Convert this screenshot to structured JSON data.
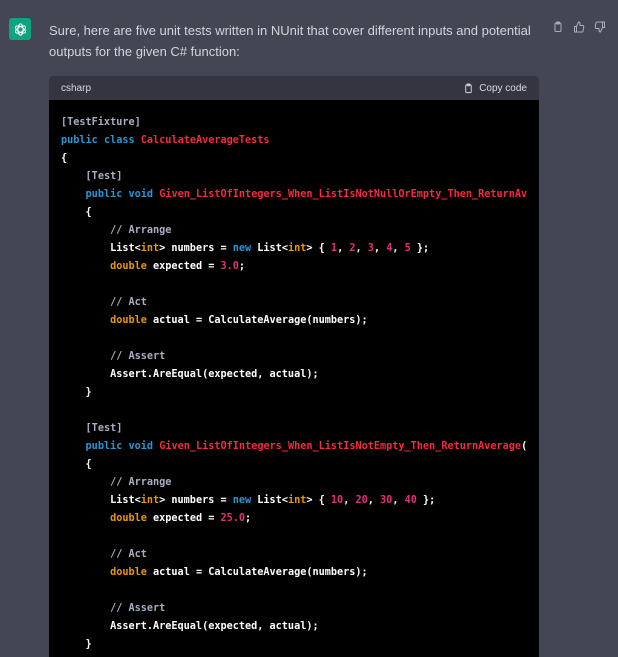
{
  "message": {
    "text": "Sure, here are five unit tests written in NUnit that cover different inputs and potential outputs for the given C# function:"
  },
  "actions": {
    "copy_icon": "clipboard-icon",
    "like_icon": "thumbs-up-icon",
    "dislike_icon": "thumbs-down-icon"
  },
  "code_block": {
    "language": "csharp",
    "copy_label": "Copy code",
    "lines": [
      {
        "parts": [
          {
            "t": "[TestFixture]",
            "c": "attr"
          }
        ]
      },
      {
        "parts": [
          {
            "t": "public",
            "c": "kw"
          },
          {
            "t": " ",
            "c": ""
          },
          {
            "t": "class",
            "c": "kw"
          },
          {
            "t": " ",
            "c": ""
          },
          {
            "t": "CalculateAverageTests",
            "c": "cls"
          }
        ]
      },
      {
        "parts": [
          {
            "t": "{",
            "c": ""
          }
        ]
      },
      {
        "parts": [
          {
            "t": "    ",
            "c": ""
          },
          {
            "t": "[Test]",
            "c": "attr"
          }
        ]
      },
      {
        "parts": [
          {
            "t": "    ",
            "c": ""
          },
          {
            "t": "public",
            "c": "kw"
          },
          {
            "t": " ",
            "c": ""
          },
          {
            "t": "void",
            "c": "kw"
          },
          {
            "t": " ",
            "c": ""
          },
          {
            "t": "Given_ListOfIntegers_When_ListIsNotNullOrEmpty_Then_ReturnAv",
            "c": "cls"
          }
        ]
      },
      {
        "parts": [
          {
            "t": "    {",
            "c": ""
          }
        ]
      },
      {
        "parts": [
          {
            "t": "        ",
            "c": ""
          },
          {
            "t": "// Arrange",
            "c": "cm"
          }
        ]
      },
      {
        "parts": [
          {
            "t": "        List<",
            "c": ""
          },
          {
            "t": "int",
            "c": "ty"
          },
          {
            "t": "> numbers = ",
            "c": ""
          },
          {
            "t": "new",
            "c": "kw"
          },
          {
            "t": " List<",
            "c": ""
          },
          {
            "t": "int",
            "c": "ty"
          },
          {
            "t": "> { ",
            "c": ""
          },
          {
            "t": "1",
            "c": "num"
          },
          {
            "t": ", ",
            "c": ""
          },
          {
            "t": "2",
            "c": "num"
          },
          {
            "t": ", ",
            "c": ""
          },
          {
            "t": "3",
            "c": "num"
          },
          {
            "t": ", ",
            "c": ""
          },
          {
            "t": "4",
            "c": "num"
          },
          {
            "t": ", ",
            "c": ""
          },
          {
            "t": "5",
            "c": "num"
          },
          {
            "t": " };",
            "c": ""
          }
        ]
      },
      {
        "parts": [
          {
            "t": "        ",
            "c": ""
          },
          {
            "t": "double",
            "c": "ty"
          },
          {
            "t": " expected = ",
            "c": ""
          },
          {
            "t": "3.0",
            "c": "num"
          },
          {
            "t": ";",
            "c": ""
          }
        ]
      },
      {
        "parts": [
          {
            "t": "",
            "c": ""
          }
        ]
      },
      {
        "parts": [
          {
            "t": "        ",
            "c": ""
          },
          {
            "t": "// Act",
            "c": "cm"
          }
        ]
      },
      {
        "parts": [
          {
            "t": "        ",
            "c": ""
          },
          {
            "t": "double",
            "c": "ty"
          },
          {
            "t": " actual = CalculateAverage(numbers);",
            "c": ""
          }
        ]
      },
      {
        "parts": [
          {
            "t": "",
            "c": ""
          }
        ]
      },
      {
        "parts": [
          {
            "t": "        ",
            "c": ""
          },
          {
            "t": "// Assert",
            "c": "cm"
          }
        ]
      },
      {
        "parts": [
          {
            "t": "        Assert.AreEqual(expected, actual);",
            "c": ""
          }
        ]
      },
      {
        "parts": [
          {
            "t": "    }",
            "c": ""
          }
        ]
      },
      {
        "parts": [
          {
            "t": "",
            "c": ""
          }
        ]
      },
      {
        "parts": [
          {
            "t": "    ",
            "c": ""
          },
          {
            "t": "[Test]",
            "c": "attr"
          }
        ]
      },
      {
        "parts": [
          {
            "t": "    ",
            "c": ""
          },
          {
            "t": "public",
            "c": "kw"
          },
          {
            "t": " ",
            "c": ""
          },
          {
            "t": "void",
            "c": "kw"
          },
          {
            "t": " ",
            "c": ""
          },
          {
            "t": "Given_ListOfIntegers_When_ListIsNotEmpty_Then_ReturnAverage",
            "c": "cls"
          },
          {
            "t": "(",
            "c": ""
          }
        ]
      },
      {
        "parts": [
          {
            "t": "    {",
            "c": ""
          }
        ]
      },
      {
        "parts": [
          {
            "t": "        ",
            "c": ""
          },
          {
            "t": "// Arrange",
            "c": "cm"
          }
        ]
      },
      {
        "parts": [
          {
            "t": "        List<",
            "c": ""
          },
          {
            "t": "int",
            "c": "ty"
          },
          {
            "t": "> numbers = ",
            "c": ""
          },
          {
            "t": "new",
            "c": "kw"
          },
          {
            "t": " List<",
            "c": ""
          },
          {
            "t": "int",
            "c": "ty"
          },
          {
            "t": "> { ",
            "c": ""
          },
          {
            "t": "10",
            "c": "num"
          },
          {
            "t": ", ",
            "c": ""
          },
          {
            "t": "20",
            "c": "num"
          },
          {
            "t": ", ",
            "c": ""
          },
          {
            "t": "30",
            "c": "num"
          },
          {
            "t": ", ",
            "c": ""
          },
          {
            "t": "40",
            "c": "num"
          },
          {
            "t": " };",
            "c": ""
          }
        ]
      },
      {
        "parts": [
          {
            "t": "        ",
            "c": ""
          },
          {
            "t": "double",
            "c": "ty"
          },
          {
            "t": " expected = ",
            "c": ""
          },
          {
            "t": "25.0",
            "c": "num"
          },
          {
            "t": ";",
            "c": ""
          }
        ]
      },
      {
        "parts": [
          {
            "t": "",
            "c": ""
          }
        ]
      },
      {
        "parts": [
          {
            "t": "        ",
            "c": ""
          },
          {
            "t": "// Act",
            "c": "cm"
          }
        ]
      },
      {
        "parts": [
          {
            "t": "        ",
            "c": ""
          },
          {
            "t": "double",
            "c": "ty"
          },
          {
            "t": " actual = CalculateAverage(numbers);",
            "c": ""
          }
        ]
      },
      {
        "parts": [
          {
            "t": "",
            "c": ""
          }
        ]
      },
      {
        "parts": [
          {
            "t": "        ",
            "c": ""
          },
          {
            "t": "// Assert",
            "c": "cm"
          }
        ]
      },
      {
        "parts": [
          {
            "t": "        Assert.AreEqual(expected, actual);",
            "c": ""
          }
        ]
      },
      {
        "parts": [
          {
            "t": "    }",
            "c": ""
          }
        ]
      }
    ]
  },
  "colors": {
    "background": "#444654",
    "code_background": "#000000",
    "code_header": "#343541",
    "avatar": "#10a37f",
    "keyword": "#2e95d3",
    "type": "#e9950c",
    "identifier": "#f22c3d",
    "number": "#df3079",
    "comment": "#a9aec1"
  }
}
